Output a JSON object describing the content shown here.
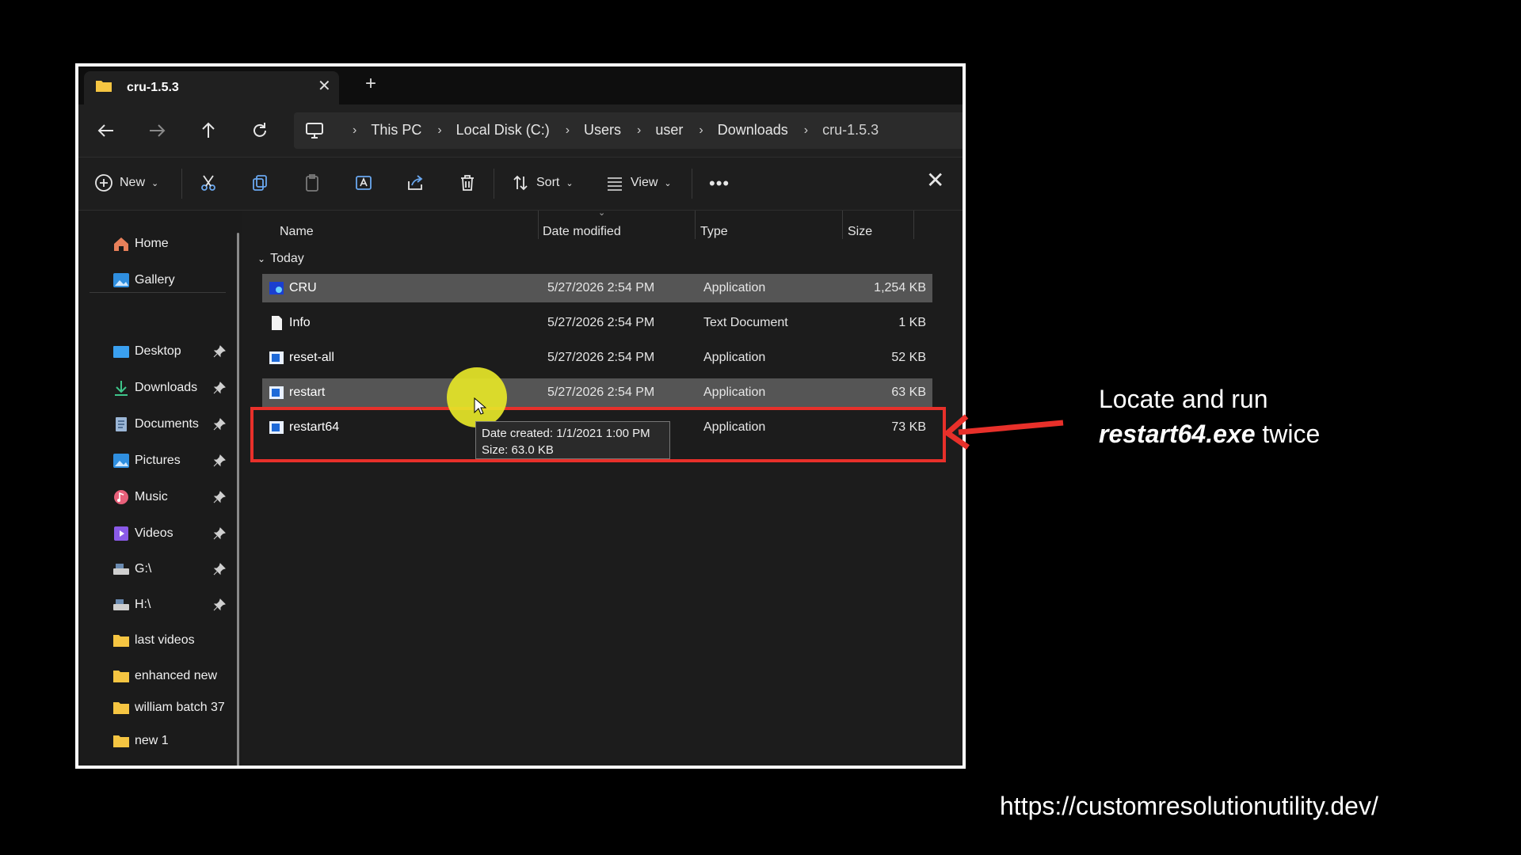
{
  "tab": {
    "title": "cru-1.5.3",
    "close_icon": "close-icon",
    "new_icon": "plus-icon"
  },
  "breadcrumbs": [
    "This PC",
    "Local Disk (C:)",
    "Users",
    "user",
    "Downloads",
    "cru-1.5.3"
  ],
  "toolbar": {
    "new_label": "New",
    "sort_label": "Sort",
    "view_label": "View"
  },
  "sidebar": {
    "quick": [
      {
        "label": "Home",
        "icon": "home-icon"
      },
      {
        "label": "Gallery",
        "icon": "gallery-icon"
      }
    ],
    "pinned": [
      {
        "label": "Desktop",
        "icon": "desktop-icon"
      },
      {
        "label": "Downloads",
        "icon": "download-icon"
      },
      {
        "label": "Documents",
        "icon": "document-icon"
      },
      {
        "label": "Pictures",
        "icon": "pictures-icon"
      },
      {
        "label": "Music",
        "icon": "music-icon"
      },
      {
        "label": "Videos",
        "icon": "videos-icon"
      },
      {
        "label": "G:\\",
        "icon": "drive-icon"
      },
      {
        "label": "H:\\",
        "icon": "drive-icon"
      }
    ],
    "folders": [
      "last videos",
      "enhanced new",
      "william batch 37",
      "new 1"
    ]
  },
  "columns": {
    "name": "Name",
    "date": "Date modified",
    "type": "Type",
    "size": "Size"
  },
  "group_label": "Today",
  "files": [
    {
      "name": "CRU",
      "date": "5/27/2026 2:54 PM",
      "type": "Application",
      "size": "1,254 KB"
    },
    {
      "name": "Info",
      "date": "5/27/2026 2:54 PM",
      "type": "Text Document",
      "size": "1 KB"
    },
    {
      "name": "reset-all",
      "date": "5/27/2026 2:54 PM",
      "type": "Application",
      "size": "52 KB"
    },
    {
      "name": "restart",
      "date": "5/27/2026 2:54 PM",
      "type": "Application",
      "size": "63 KB"
    },
    {
      "name": "restart64",
      "date": "",
      "type": "Application",
      "size": "73 KB"
    }
  ],
  "tooltip": {
    "line1": "Date created: 1/1/2021 1:00 PM",
    "line2": "Size: 63.0 KB"
  },
  "annotation": {
    "line1": "Locate and run",
    "bold": "restart64.exe",
    "suffix": " twice"
  },
  "url": "https://customresolutionutility.dev/",
  "colors": {
    "highlight": "#e8302a",
    "cursor": "#e6e628",
    "selection": "#555555"
  }
}
